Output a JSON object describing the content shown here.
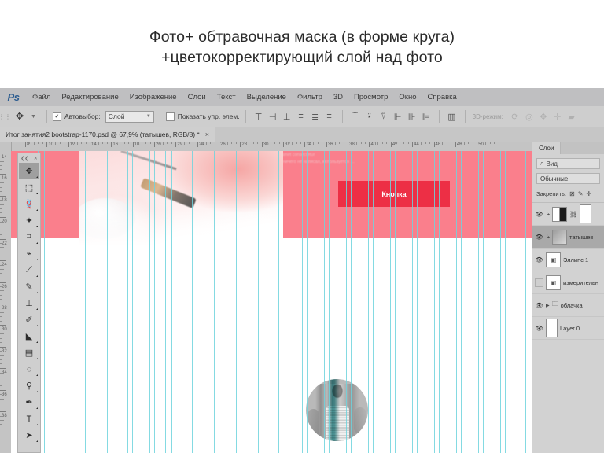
{
  "slide": {
    "title_line1": "Фото+ обтравочная маска (в форме круга)",
    "title_line2": "+цветокорректирующий слой над фото"
  },
  "app": {
    "logo": "Ps",
    "menu": [
      {
        "label": "Файл"
      },
      {
        "label": "Редактирование"
      },
      {
        "label": "Изображение"
      },
      {
        "label": "Слои"
      },
      {
        "label": "Текст"
      },
      {
        "label": "Выделение"
      },
      {
        "label": "Фильтр"
      },
      {
        "label": "3D"
      },
      {
        "label": "Просмотр"
      },
      {
        "label": "Окно"
      },
      {
        "label": "Справка"
      }
    ]
  },
  "options_bar": {
    "active_tool_icon": "move-tool",
    "autoselect_label": "Автовыбор:",
    "autoselect_checked": true,
    "autoselect_value": "Слой",
    "show_controls_label": "Показать упр. элем.",
    "show_controls_checked": false,
    "mode3d_label": "3D-режим:",
    "align_icons": [
      "align-top-edges",
      "align-vertical-centers",
      "align-bottom-edges",
      "align-left-edges",
      "align-horizontal-centers",
      "align-right-edges",
      "distribute-top",
      "distribute-vertical-center",
      "distribute-bottom",
      "distribute-left",
      "distribute-horizontal-center",
      "distribute-right",
      "auto-align-layers"
    ],
    "mode3d_icons": [
      "rotate-3d",
      "roll-3d",
      "pan-3d",
      "slide-3d",
      "scale-3d"
    ]
  },
  "document": {
    "tab_title": "Итог занятия2 bootstrap-1170.psd @ 67,9% (татышев, RGB/8) *",
    "close_glyph": "×"
  },
  "rulers": {
    "horizontal_ticks": [
      "8",
      "10",
      "12",
      "14",
      "16",
      "18",
      "20",
      "22",
      "24",
      "26",
      "28",
      "30",
      "32",
      "34",
      "36",
      "38",
      "40",
      "42",
      "44",
      "46",
      "48",
      "50"
    ],
    "vertical_ticks": [
      "14",
      "16",
      "18",
      "20",
      "22",
      "24",
      "26",
      "28",
      "30",
      "32",
      "34",
      "36",
      "38"
    ]
  },
  "tools": [
    {
      "name": "move-tool",
      "glyph": "✥",
      "selected": true
    },
    {
      "name": "rectangular-marquee-tool",
      "glyph": "⬚",
      "selected": false
    },
    {
      "name": "lasso-tool",
      "glyph": "🪢",
      "selected": false
    },
    {
      "name": "magic-wand-tool",
      "glyph": "✦",
      "selected": false
    },
    {
      "name": "crop-tool",
      "glyph": "⌗",
      "selected": false
    },
    {
      "name": "eyedropper-tool",
      "glyph": "⌁",
      "selected": false
    },
    {
      "name": "healing-brush-tool",
      "glyph": "⟋",
      "selected": false
    },
    {
      "name": "brush-tool",
      "glyph": "✎",
      "selected": false
    },
    {
      "name": "clone-stamp-tool",
      "glyph": "⊥",
      "selected": false
    },
    {
      "name": "history-brush-tool",
      "glyph": "✐",
      "selected": false
    },
    {
      "name": "eraser-tool",
      "glyph": "◣",
      "selected": false
    },
    {
      "name": "gradient-tool",
      "glyph": "▤",
      "selected": false
    },
    {
      "name": "blur-tool",
      "glyph": "◌",
      "selected": false
    },
    {
      "name": "dodge-tool",
      "glyph": "⚲",
      "selected": false
    },
    {
      "name": "pen-tool",
      "glyph": "✒",
      "selected": false
    },
    {
      "name": "type-tool",
      "glyph": "T",
      "selected": false
    },
    {
      "name": "path-selection-tool",
      "glyph": "➤",
      "selected": false
    }
  ],
  "canvas": {
    "hero_text_line1": "Lorem ipsum dolor sit amet consectetur",
    "hero_text_line2": "Если компьютер ещё ничего не написал, используется …",
    "button_label": "Кнопка"
  },
  "layers_panel": {
    "tab_label": "Слои",
    "search_icon": "search-icon",
    "search_placeholder": "Вид",
    "blend_mode": "Обычные",
    "lock_label": "Закрепить:",
    "rows": [
      {
        "name": "",
        "visible": true,
        "selected": false,
        "thumb": "mask",
        "clipped": true,
        "linked": true,
        "underline": false
      },
      {
        "name": "татышев",
        "visible": true,
        "selected": true,
        "thumb": "img",
        "clipped": true,
        "linked": false,
        "underline": false
      },
      {
        "name": "Эллипс 1",
        "visible": true,
        "selected": false,
        "thumb": "vec",
        "clipped": false,
        "linked": false,
        "underline": true
      },
      {
        "name": "измерительн",
        "visible": false,
        "selected": false,
        "thumb": "vec",
        "clipped": false,
        "linked": false,
        "underline": false
      },
      {
        "name": "облачка",
        "visible": true,
        "selected": false,
        "thumb": "folder",
        "clipped": false,
        "linked": false,
        "underline": false
      },
      {
        "name": "Layer 0",
        "visible": true,
        "selected": false,
        "thumb": "white",
        "clipped": false,
        "linked": false,
        "underline": false
      }
    ]
  },
  "colors": {
    "hero_pink": "#fa7f8c",
    "button_red": "#ed2f45",
    "guide_cyan": "#6fd3dd",
    "panel_gray": "#d2d2d2",
    "menubar_gray": "#bfbfc1"
  }
}
